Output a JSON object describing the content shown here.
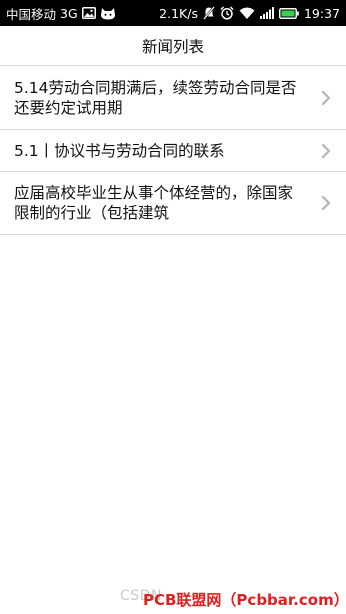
{
  "status_bar": {
    "carrier": "中国移动",
    "network": "3G",
    "speed": "2.1K/s",
    "time": "19:37",
    "icons": [
      "image-icon",
      "cat-icon",
      "mute-icon",
      "alarm-icon",
      "wifi-icon",
      "signal-icon",
      "battery-icon"
    ]
  },
  "header": {
    "title": "新闻列表"
  },
  "news": {
    "items": [
      {
        "title": " 5.14劳动合同期满后，续签劳动合同是否还要约定试用期"
      },
      {
        "title": "5.1丨协议书与劳动合同的联系"
      },
      {
        "title": "应届高校毕业生从事个体经营的，除国家限制的行业（包括建筑"
      }
    ]
  },
  "watermark": {
    "csdn": "CSDN",
    "pcb": "PCB联盟网（Pcbbar.com）"
  },
  "colors": {
    "status_bar_bg": "#000000",
    "divider": "#d6d6d6",
    "chevron": "#b5b5b5",
    "watermark_red": "#e02020"
  }
}
